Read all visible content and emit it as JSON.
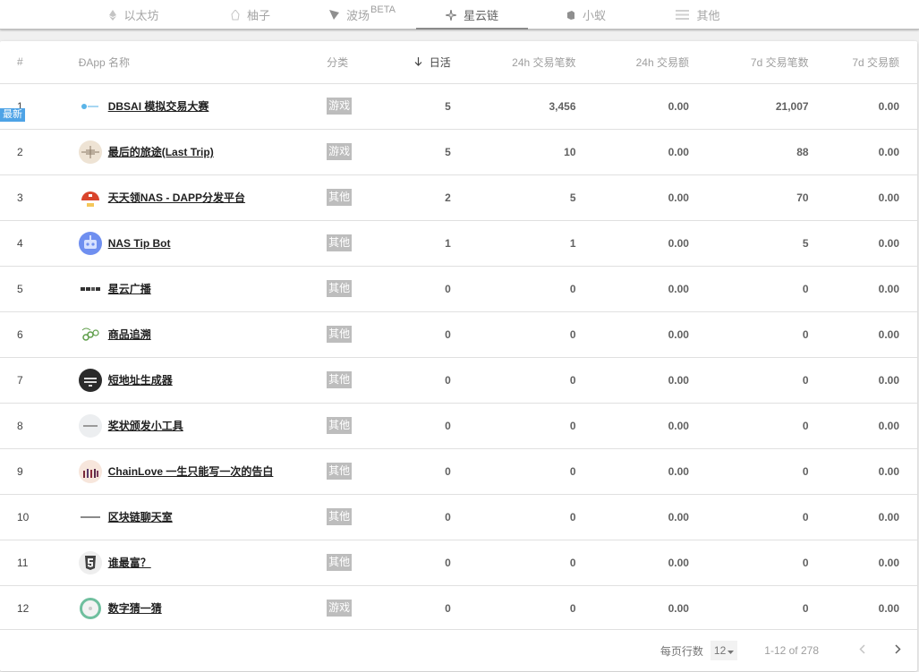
{
  "tabs": [
    {
      "label": "以太坊",
      "icon": "ethereum-icon",
      "active": false
    },
    {
      "label": "柚子",
      "icon": "eos-icon",
      "active": false
    },
    {
      "label": "波场",
      "icon": "tron-icon",
      "badge": "BETA",
      "active": false
    },
    {
      "label": "星云链",
      "icon": "nebulas-icon",
      "active": true
    },
    {
      "label": "小蚁",
      "icon": "neo-icon",
      "active": false
    },
    {
      "label": "其他",
      "icon": "menu-icon",
      "active": false
    }
  ],
  "table": {
    "columns": {
      "rank": "#",
      "name": "ÐApp 名称",
      "category": "分类",
      "dau": "日活",
      "tx24h": "24h 交易笔数",
      "vol24h": "24h 交易额",
      "tx7d": "7d 交易笔数",
      "vol7d": "7d 交易额"
    },
    "sorted_by": "dau",
    "sort_direction": "desc",
    "new_badge": "最新",
    "rows": [
      {
        "rank": "1",
        "name": "DBSAI 模拟交易大赛",
        "category": "游戏",
        "dau": "5",
        "tx24h": "3,456",
        "vol24h": "0.00",
        "tx7d": "21,007",
        "vol7d": "0.00",
        "logo": "dbsai-logo"
      },
      {
        "rank": "2",
        "name": "最后的旅途(Last Trip)",
        "category": "游戏",
        "dau": "5",
        "tx24h": "10",
        "vol24h": "0.00",
        "tx7d": "88",
        "vol7d": "0.00",
        "logo": "last-trip-logo",
        "is_new": true
      },
      {
        "rank": "3",
        "name": "天天领NAS - DAPP分发平台",
        "category": "其他",
        "dau": "2",
        "tx24h": "5",
        "vol24h": "0.00",
        "tx7d": "70",
        "vol7d": "0.00",
        "logo": "tiantianling-logo"
      },
      {
        "rank": "4",
        "name": "NAS Tip Bot",
        "category": "其他",
        "dau": "1",
        "tx24h": "1",
        "vol24h": "0.00",
        "tx7d": "5",
        "vol7d": "0.00",
        "logo": "robot-logo"
      },
      {
        "rank": "5",
        "name": "星云广播",
        "category": "其他",
        "dau": "0",
        "tx24h": "0",
        "vol24h": "0.00",
        "tx7d": "0",
        "vol7d": "0.00",
        "logo": "broadcast-logo"
      },
      {
        "rank": "6",
        "name": "商品追溯",
        "category": "其他",
        "dau": "0",
        "tx24h": "0",
        "vol24h": "0.00",
        "tx7d": "0",
        "vol7d": "0.00",
        "logo": "trace-logo"
      },
      {
        "rank": "7",
        "name": "短地址生成器",
        "category": "其他",
        "dau": "0",
        "tx24h": "0",
        "vol24h": "0.00",
        "tx7d": "0",
        "vol7d": "0.00",
        "logo": "shorturl-logo"
      },
      {
        "rank": "8",
        "name": "奖状颁发小工具",
        "category": "其他",
        "dau": "0",
        "tx24h": "0",
        "vol24h": "0.00",
        "tx7d": "0",
        "vol7d": "0.00",
        "logo": "certificate-logo"
      },
      {
        "rank": "9",
        "name": "ChainLove 一生只能写一次的告白",
        "category": "其他",
        "dau": "0",
        "tx24h": "0",
        "vol24h": "0.00",
        "tx7d": "0",
        "vol7d": "0.00",
        "logo": "chainlove-logo"
      },
      {
        "rank": "10",
        "name": "区块链聊天室",
        "category": "其他",
        "dau": "0",
        "tx24h": "0",
        "vol24h": "0.00",
        "tx7d": "0",
        "vol7d": "0.00",
        "logo": "chatroom-logo"
      },
      {
        "rank": "11",
        "name": "谁最富？",
        "category": "其他",
        "dau": "0",
        "tx24h": "0",
        "vol24h": "0.00",
        "tx7d": "0",
        "vol7d": "0.00",
        "logo": "html5-logo"
      },
      {
        "rank": "12",
        "name": "数字猜一猜",
        "category": "游戏",
        "dau": "0",
        "tx24h": "0",
        "vol24h": "0.00",
        "tx7d": "0",
        "vol7d": "0.00",
        "logo": "guess-logo"
      }
    ]
  },
  "pagination": {
    "rows_per_page_label": "每页行数",
    "rows_per_page": "12",
    "range": "1-12 of 278",
    "prev_icon": "chevron-left-icon",
    "next_icon": "chevron-right-icon"
  },
  "colors": {
    "new_badge": "#4ea3e6",
    "chip_bg": "#bdbdbd",
    "active_tab_underline": "#8a8a8a"
  }
}
